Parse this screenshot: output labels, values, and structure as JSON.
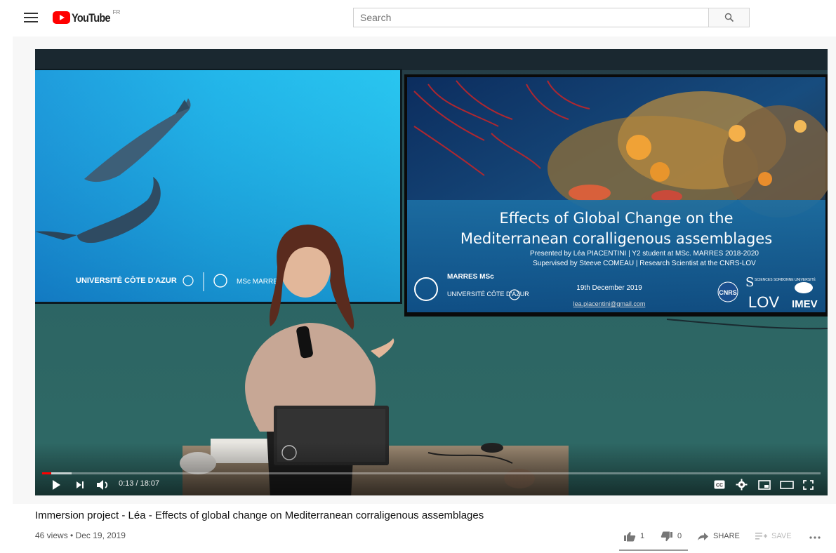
{
  "header": {
    "logo_text": "YouTube",
    "country_code": "FR",
    "search_placeholder": "Search"
  },
  "player": {
    "current_time": "0:13",
    "duration": "18:07",
    "time_display": "0:13 / 18:07",
    "progress_fraction": 0.012,
    "buffered_fraction": 0.038,
    "accent_color": "#ff0000",
    "controls": [
      "play-icon",
      "next-icon",
      "volume-icon",
      "subtitles-icon",
      "settings-icon",
      "miniplayer-icon",
      "theater-icon",
      "fullscreen-icon"
    ]
  },
  "slide_left": {
    "university": "UNIVERSITÉ CÔTE D'AZUR",
    "program_logo": "MSc MARRES"
  },
  "slide_right": {
    "title_line1": "Effects of Global Change on the",
    "title_line2": "Mediterranean coralligenous assemblages",
    "presented_by": "Presented by Léa PIACENTINI | Y2 student at MSc. MARRES 2018-2020",
    "supervised_by": "Supervised by Steeve COMEAU | Research Scientist at the CNRS-LOV",
    "date": "19th December 2019",
    "email": "lea.piacentini@gmail.com",
    "program": "MARRES MSc",
    "university": "UNIVERSITÉ CÔTE D'AZUR",
    "partner_logos": [
      "CNRS",
      "SCIENCES SORBONNE UNIVERSITÉ",
      "LOV",
      "IMEV"
    ]
  },
  "video_info": {
    "title": "Immersion project - Léa - Effects of global change on Mediterranean corraligenous assemblages",
    "meta": "46 views • Dec 19, 2019",
    "likes": "1",
    "dislikes": "0",
    "share_label": "SHARE",
    "save_label": "SAVE"
  }
}
